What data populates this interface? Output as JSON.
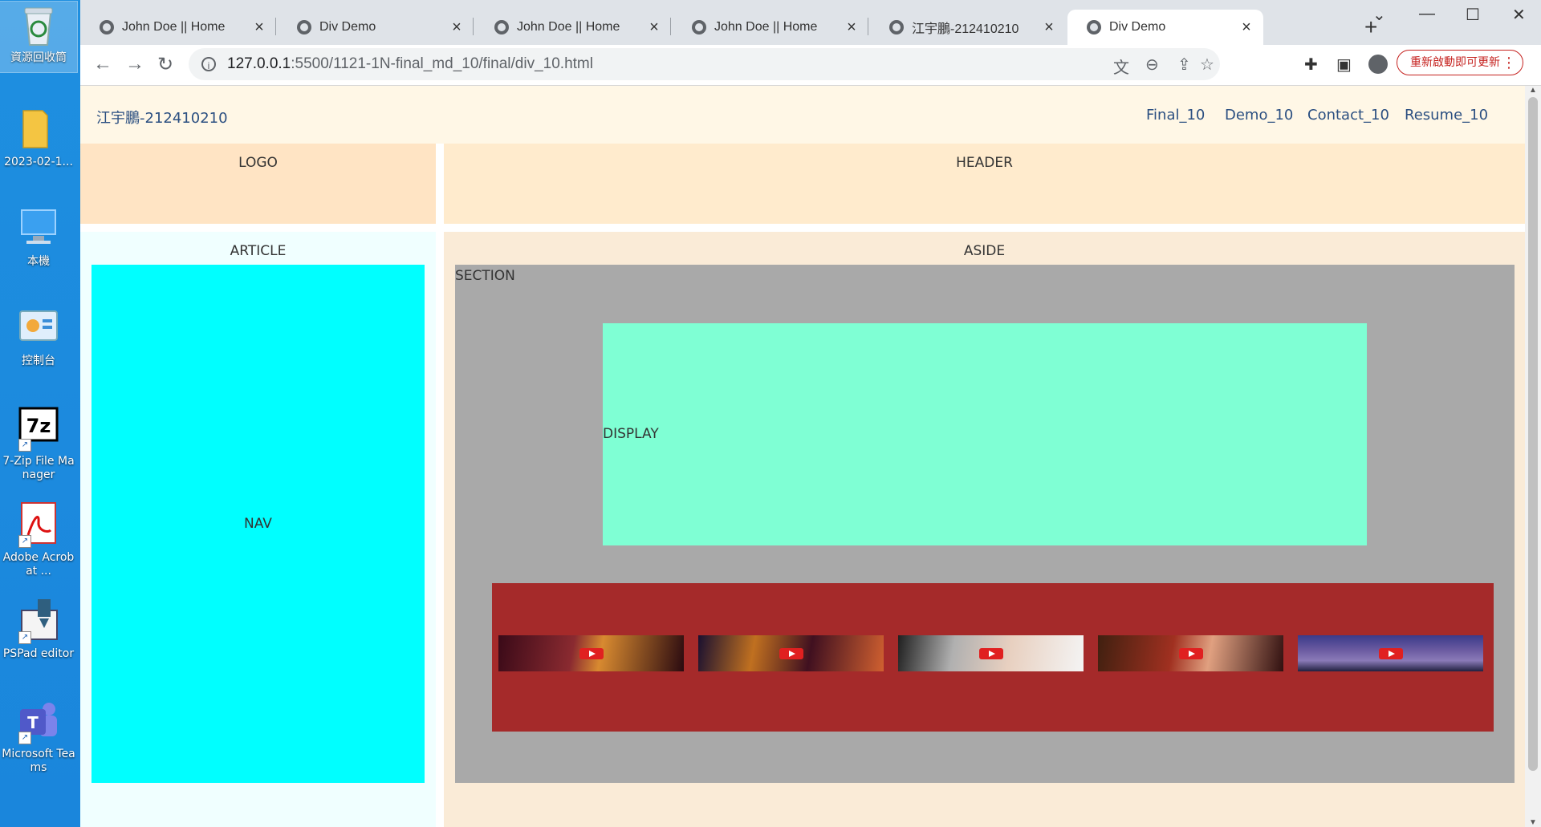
{
  "desktop": {
    "icons": [
      {
        "label": "資源回收筒",
        "icon": "recycle-bin-icon"
      },
      {
        "label": "2023-02-1...",
        "icon": "folder-icon"
      },
      {
        "label": "本機",
        "icon": "computer-icon"
      },
      {
        "label": "控制台",
        "icon": "control-panel-icon"
      },
      {
        "label": "7-Zip File Manager",
        "icon": "7zip-icon"
      },
      {
        "label": "Adobe Acrobat ...",
        "icon": "acrobat-icon"
      },
      {
        "label": "PSPad editor",
        "icon": "pspad-icon"
      },
      {
        "label": "Microsoft Teams",
        "icon": "teams-icon"
      }
    ]
  },
  "browser": {
    "tabs": [
      {
        "title": "John Doe || Home",
        "active": false
      },
      {
        "title": "Div Demo",
        "active": false
      },
      {
        "title": "John Doe || Home",
        "active": false
      },
      {
        "title": "John Doe || Home",
        "active": false
      },
      {
        "title": "江宇鵬-212410210",
        "active": false
      },
      {
        "title": "Div Demo",
        "active": true
      }
    ],
    "url_host": "127.0.0.1",
    "url_path": ":5500/1121-1N-final_md_10/final/div_10.html",
    "update_button": "重新啟動即可更新"
  },
  "page": {
    "brand": "江宇鵬-212410210",
    "menu": [
      "Final_10",
      "Demo_10",
      "Contact_10",
      "Resume_10"
    ],
    "logo": "LOGO",
    "header": "HEADER",
    "article": "ARTICLE",
    "aside": "ASIDE",
    "nav": "NAV",
    "section": "SECTION",
    "display": "DISPLAY",
    "video_thumbnails": 5
  },
  "colors": {
    "nav_bg": "#fff7e6",
    "logo_bg": "#ffe4c4",
    "header_bg": "#ffebcd",
    "article_bg": "#f0ffff",
    "aside_bg": "#faebd7",
    "nav_box": "#00ffff",
    "section_bg": "#a9a9a9",
    "display_bg": "#7fffd4",
    "video_strip_bg": "#a52a2a"
  }
}
